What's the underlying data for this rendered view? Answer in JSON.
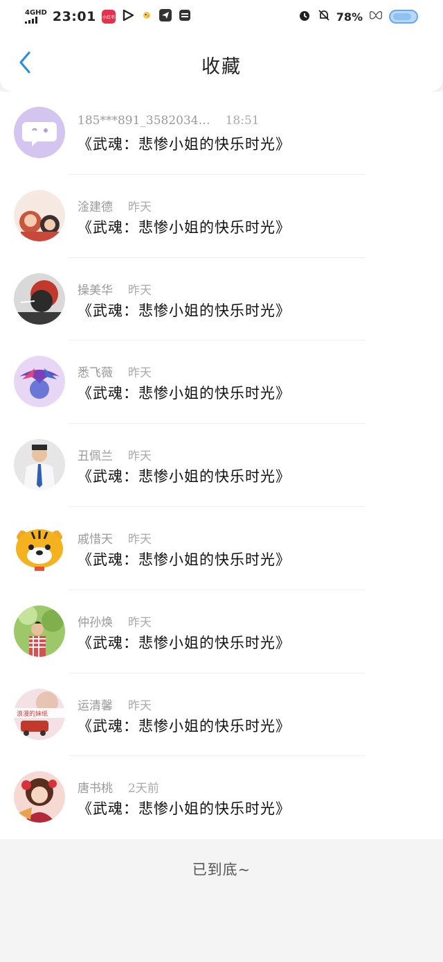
{
  "status_bar": {
    "network": "4GHD",
    "time": "23:01",
    "app_badge": "小红书",
    "battery": "78%"
  },
  "header": {
    "title": "收藏"
  },
  "items": [
    {
      "name": "185***891_3582034…",
      "time": "18:51",
      "text": "《武魂：悲惨小姐的快乐时光》"
    },
    {
      "name": "淦建德",
      "time": "昨天",
      "text": "《武魂：悲惨小姐的快乐时光》"
    },
    {
      "name": "操美华",
      "time": "昨天",
      "text": "《武魂：悲惨小姐的快乐时光》"
    },
    {
      "name": "悉飞薇",
      "time": "昨天",
      "text": "《武魂：悲惨小姐的快乐时光》"
    },
    {
      "name": "丑佩兰",
      "time": "昨天",
      "text": "《武魂：悲惨小姐的快乐时光》"
    },
    {
      "name": "戚惜天",
      "time": "昨天",
      "text": "《武魂：悲惨小姐的快乐时光》"
    },
    {
      "name": "仲孙焕",
      "time": "昨天",
      "text": "《武魂：悲惨小姐的快乐时光》"
    },
    {
      "name": "运清馨",
      "time": "昨天",
      "text": "《武魂：悲惨小姐的快乐时光》"
    },
    {
      "name": "唐书桃",
      "time": "2天前",
      "text": "《武魂：悲惨小姐的快乐时光》"
    }
  ],
  "avatar_8_text": "浪漫的妹纸",
  "footer": {
    "end_text": "已到底~"
  },
  "colors": {
    "accent": "#2a8ee6",
    "background": "#f5f4f4"
  }
}
